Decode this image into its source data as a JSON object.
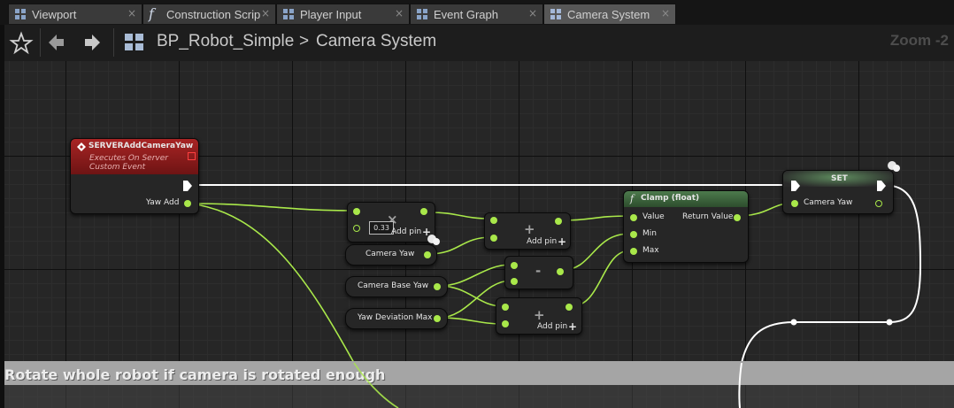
{
  "tabs": [
    {
      "label": "Viewport",
      "icon": "viewport-icon",
      "close": "×"
    },
    {
      "label": "Construction Scrip",
      "icon": "function-icon",
      "close": "×"
    },
    {
      "label": "Player Input",
      "icon": "graph-icon",
      "close": "×"
    },
    {
      "label": "Event Graph",
      "icon": "graph-icon",
      "close": "×"
    },
    {
      "label": "Camera System",
      "icon": "graph-icon",
      "close": "×"
    }
  ],
  "toolbar": {
    "blueprint_name": "BP_Robot_Simple",
    "separator": ">",
    "graph_name": "Camera System",
    "zoom": "Zoom -2"
  },
  "nodes": {
    "event": {
      "title": "SERVERAddCameraYaw",
      "subtitle1": "Executes On Server",
      "subtitle2": "Custom Event",
      "output": "Yaw Add"
    },
    "multiply": {
      "operator": "×",
      "value": "0.33",
      "add_pin": "Add pin",
      "plus": "+"
    },
    "add1": {
      "operator": "+",
      "add_pin": "Add pin",
      "plus": "+"
    },
    "get_camera_yaw": {
      "label": "Camera Yaw"
    },
    "get_camera_base_yaw": {
      "label": "Camera Base Yaw"
    },
    "get_yaw_deviation_max": {
      "label": "Yaw Deviation Max"
    },
    "subtract": {
      "operator": "-"
    },
    "add2": {
      "operator": "+",
      "add_pin": "Add pin",
      "plus": "+"
    },
    "clamp": {
      "title": "Clamp (float)",
      "func_glyph": "f",
      "value": "Value",
      "min": "Min",
      "max": "Max",
      "return": "Return Value"
    },
    "set": {
      "title": "SET",
      "input": "Camera Yaw"
    }
  },
  "comment": {
    "text": "Rotate whole robot if camera is rotated enough"
  },
  "colors": {
    "float_pin": "#a9e84a",
    "event_header": "#8c1d1d",
    "function_header": "#3d6a3d",
    "exec_wire": "#ffffff"
  }
}
